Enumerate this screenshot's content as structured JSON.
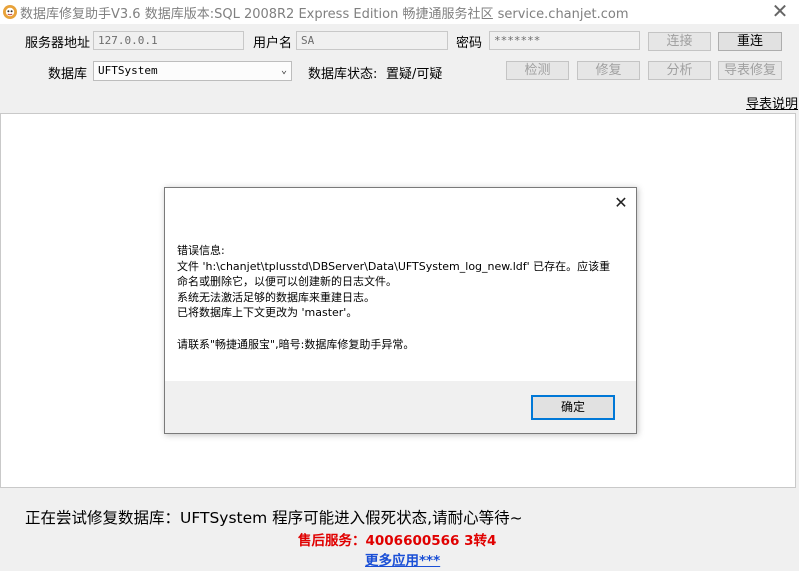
{
  "window": {
    "title": "数据库修复助手V3.6 数据库版本:SQL 2008R2 Express Edition   畅捷通服务社区 service.chanjet.com",
    "close_glyph": "✕"
  },
  "form": {
    "server_label": "服务器地址",
    "server_value": "127.0.0.1",
    "user_label": "用户名",
    "user_value": "SA",
    "password_label": "密码",
    "password_value": "*******",
    "connect_button": "连接",
    "reconnect_button": "重连",
    "database_label": "数据库",
    "database_value": "UFTSystem",
    "db_status_label": "数据库状态:",
    "db_status_value": "置疑/可疑",
    "detect_button": "检测",
    "repair_button": "修复",
    "analyze_button": "分析",
    "import_repair_button": "导表修复",
    "import_help_link": "导表说明"
  },
  "dialog": {
    "close_glyph": "✕",
    "message_lines": [
      "错误信息:",
      "文件 'h:\\chanjet\\tplusstd\\DBServer\\Data\\UFTSystem_log_new.ldf' 已存在。应该重",
      "命名或删除它，以便可以创建新的日志文件。",
      "系统无法激活足够的数据库来重建日志。",
      "已将数据库上下文更改为 'master'。",
      "",
      "请联系\"畅捷通服宝\",暗号:数据库修复助手异常。"
    ],
    "ok_button": "确定"
  },
  "status": {
    "message": "正在尝试修复数据库：UFTSystem 程序可能进入假死状态,请耐心等待~",
    "service_line": "售后服务：4006600566 3转4",
    "more_apps_link": "更多应用***"
  },
  "colors": {
    "accent_blue": "#0078d7",
    "service_red": "#e00000",
    "link_blue": "#1a4fd6"
  }
}
